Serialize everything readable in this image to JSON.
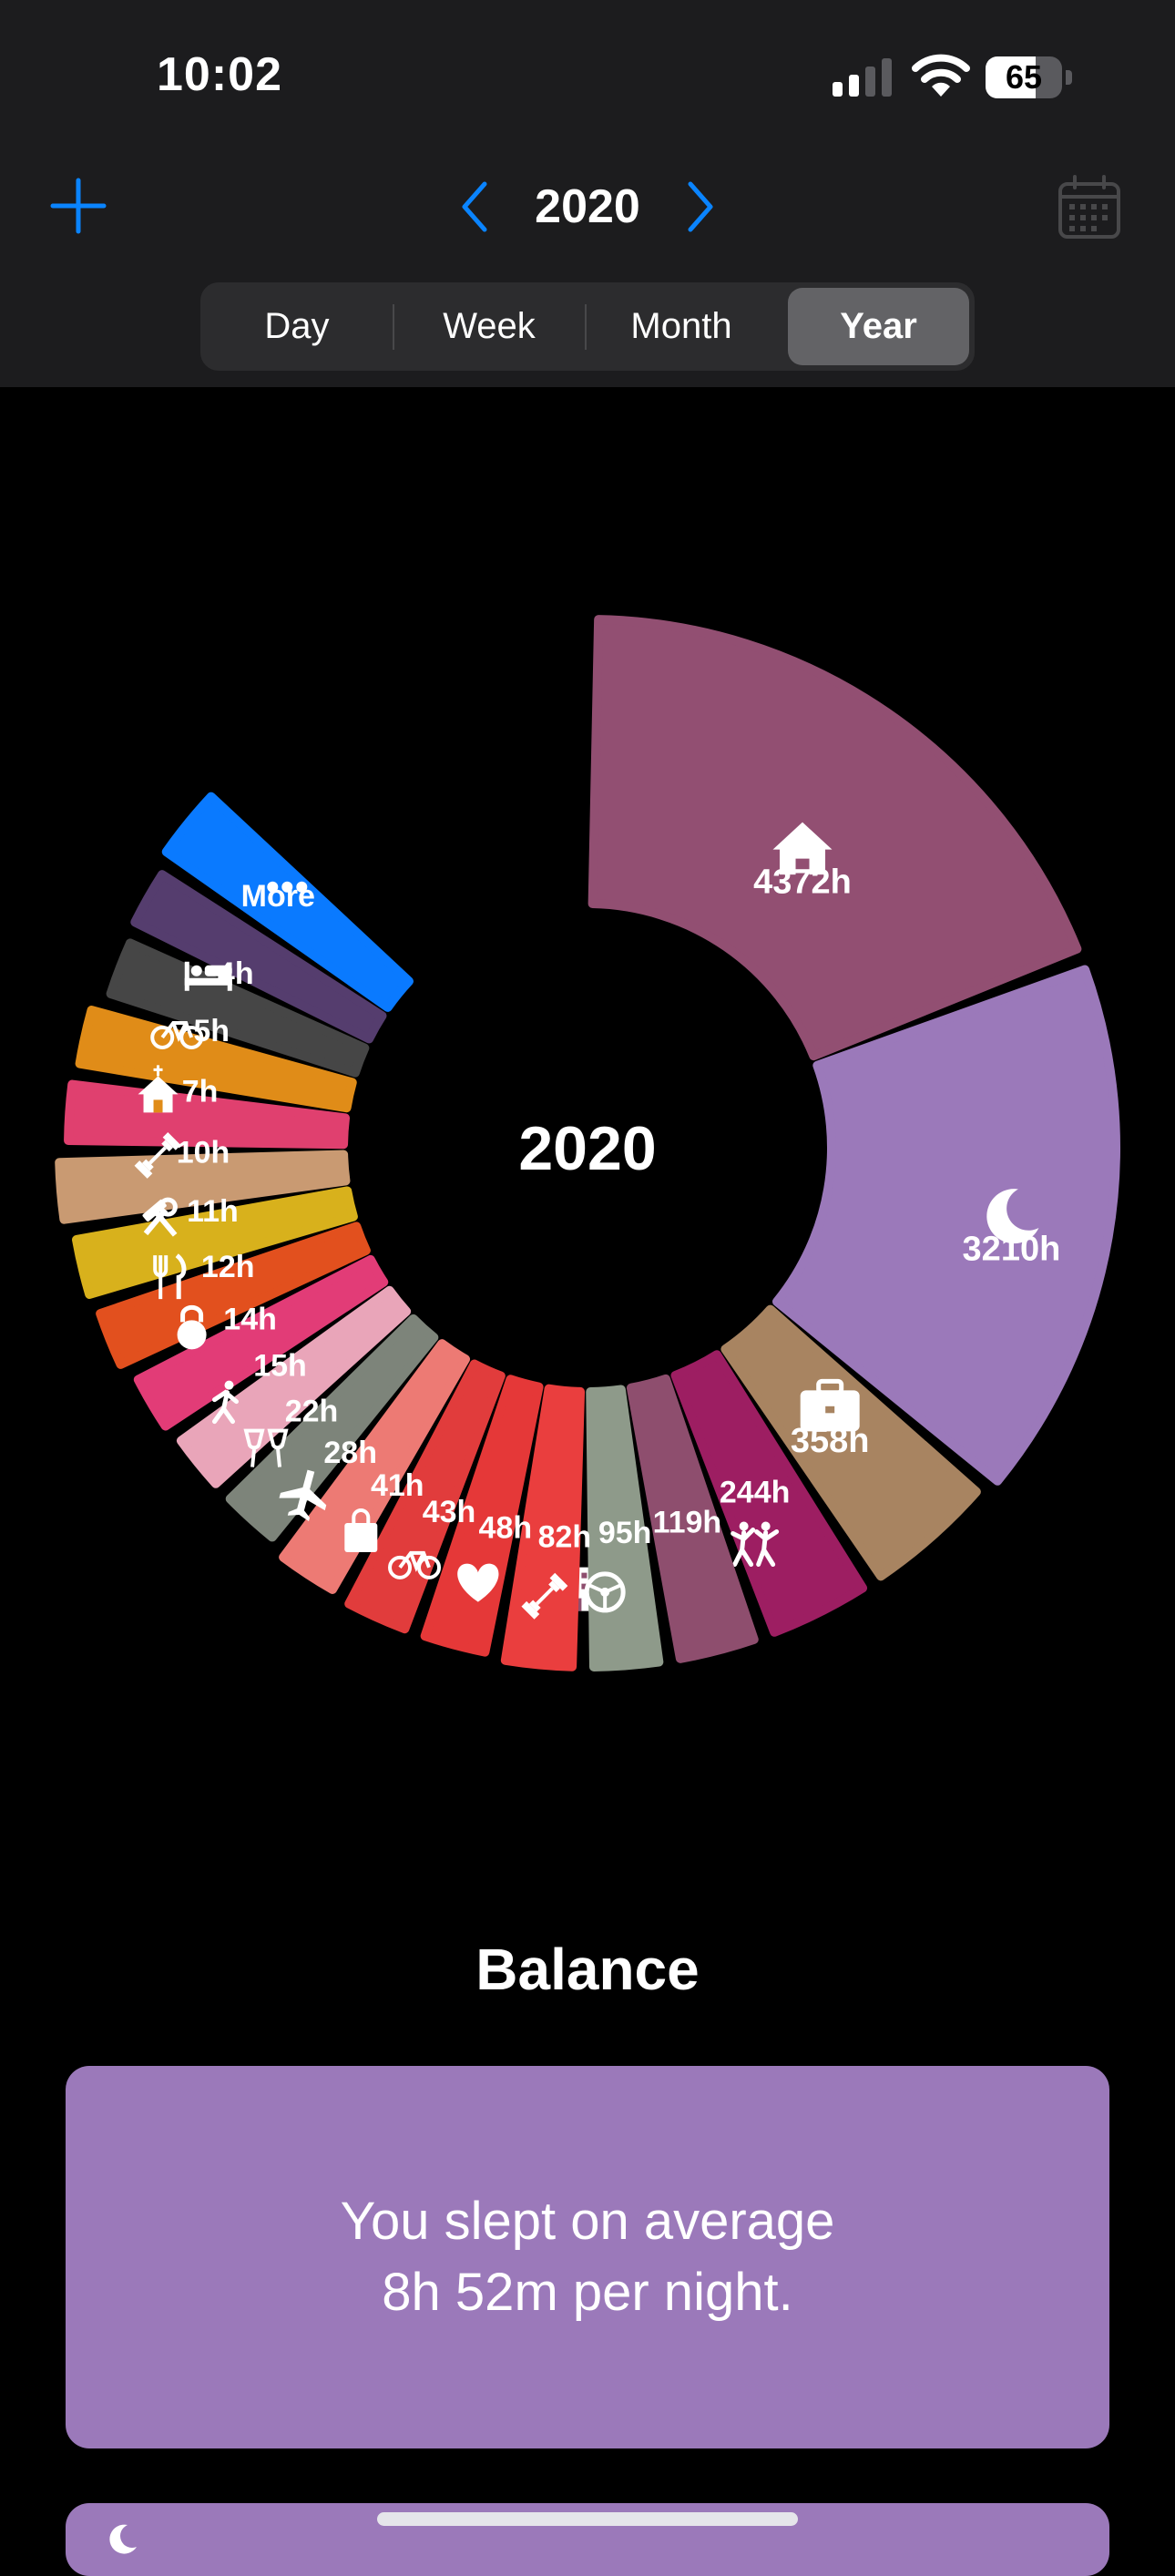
{
  "status_bar": {
    "time": "10:02",
    "battery_level": "65",
    "battery_fraction": 0.65
  },
  "header": {
    "year": "2020"
  },
  "segmented_control": {
    "options": [
      "Day",
      "Week",
      "Month",
      "Year"
    ],
    "selected": "Year"
  },
  "chart_data": {
    "type": "pie",
    "center_label": "2020",
    "slices": [
      {
        "label": "4372h",
        "value": 4372,
        "icon": "house-icon",
        "color": "#924f72"
      },
      {
        "label": "3210h",
        "value": 3210,
        "icon": "moon-icon",
        "color": "#9b79ba"
      },
      {
        "label": "358h",
        "value": 358,
        "icon": "briefcase-icon",
        "color": "#a88461"
      },
      {
        "label": "244h",
        "value": 244,
        "icon": "dancing-icon",
        "color": "#9d1e62"
      },
      {
        "label": "119h",
        "value": 119,
        "icon": "building-icon",
        "color": "#8e4e6e"
      },
      {
        "label": "95h",
        "value": 95,
        "icon": "steering-wheel-icon",
        "color": "#8e9a8a"
      },
      {
        "label": "82h",
        "value": 82,
        "icon": "dumbbell-icon",
        "color": "#ea3e3e"
      },
      {
        "label": "48h",
        "value": 48,
        "icon": "heart-icon",
        "color": "#e53838"
      },
      {
        "label": "43h",
        "value": 43,
        "icon": "bicycle-icon",
        "color": "#e13c3c"
      },
      {
        "label": "41h",
        "value": 41,
        "icon": "shopping-bag-icon",
        "color": "#ed7a74"
      },
      {
        "label": "28h",
        "value": 28,
        "icon": "airplane-icon",
        "color": "#7d847a"
      },
      {
        "label": "22h",
        "value": 22,
        "icon": "cheers-icon",
        "color": "#e9a5b9"
      },
      {
        "label": "15h",
        "value": 15,
        "icon": "walking-icon",
        "color": "#e23c77"
      },
      {
        "label": "14h",
        "value": 14,
        "icon": "kettlebell-icon",
        "color": "#e2501e"
      },
      {
        "label": "12h",
        "value": 12,
        "icon": "fork-knife-icon",
        "color": "#d8b11c"
      },
      {
        "label": "11h",
        "value": 11,
        "icon": "hammer-wrench-icon",
        "color": "#c99a72"
      },
      {
        "label": "10h",
        "value": 10,
        "icon": "dumbbell-icon",
        "color": "#e0406f"
      },
      {
        "label": "7h",
        "value": 7,
        "icon": "church-icon",
        "color": "#e08c18"
      },
      {
        "label": "5h",
        "value": 5,
        "icon": "bicycle-icon",
        "color": "#464646"
      },
      {
        "label": "4h",
        "value": 4,
        "icon": "bed-icon",
        "color": "#553d6e"
      },
      {
        "label": "More",
        "value": null,
        "icon": "more-icon",
        "color": "#0a7aff"
      }
    ]
  },
  "balance": {
    "title": "Balance",
    "card_text": "You slept on average\n8h 52m per night.",
    "card_color": "#9b79ba"
  },
  "colors": {
    "accent": "#0a84ff",
    "header_bg": "#1c1c1e"
  }
}
